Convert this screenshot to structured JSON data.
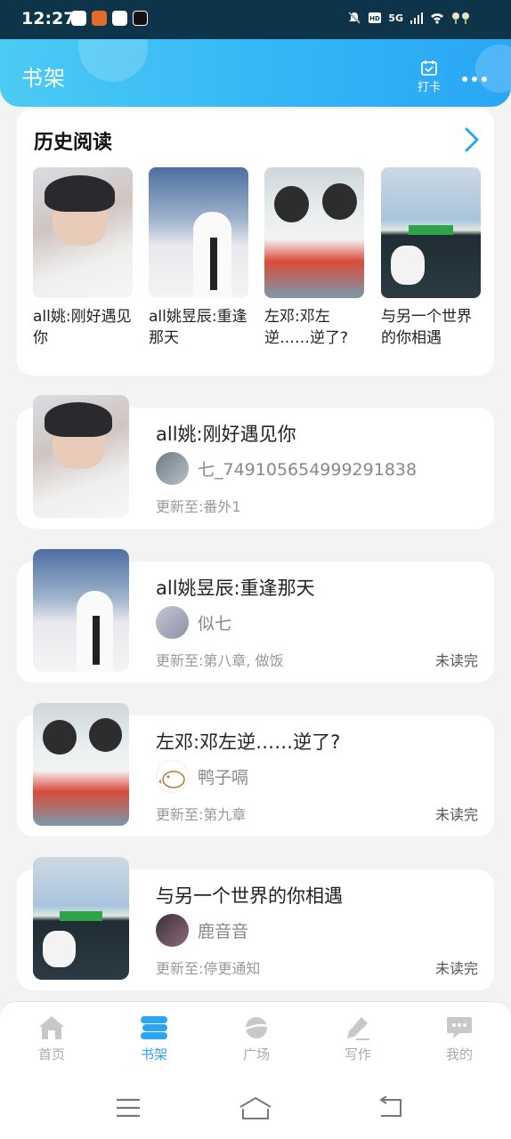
{
  "status_bar": {
    "time": "12:27",
    "network": "5G"
  },
  "header": {
    "title": "书架",
    "checkin_label": "打卡"
  },
  "history": {
    "title": "历史阅读",
    "items": [
      {
        "name": "all姚:刚好遇见你"
      },
      {
        "name": "all姚昱辰:重逢那天"
      },
      {
        "name": "左邓:邓左逆……逆了?"
      },
      {
        "name": "与另一个世界的你相遇"
      }
    ]
  },
  "shelf": {
    "update_prefix": "更新至:",
    "books": [
      {
        "title": "all姚:刚好遇见你",
        "author": "七_749105654999291838",
        "update": "更新至:番外1",
        "status": ""
      },
      {
        "title": "all姚昱辰:重逢那天",
        "author": "似七",
        "update": "更新至:第八章, 做饭",
        "status": "未读完"
      },
      {
        "title": "左邓:邓左逆……逆了?",
        "author": "鸭子嗝",
        "update": "更新至:第九章",
        "status": "未读完"
      },
      {
        "title": "与另一个世界的你相遇",
        "author": "鹿音音",
        "update": "更新至:停更通知",
        "status": "未读完"
      }
    ]
  },
  "bottom_nav": {
    "items": [
      {
        "label": "首页",
        "icon": "home-icon"
      },
      {
        "label": "书架",
        "icon": "bookshelf-icon",
        "active": true
      },
      {
        "label": "广场",
        "icon": "planet-icon"
      },
      {
        "label": "写作",
        "icon": "pen-icon"
      },
      {
        "label": "我的",
        "icon": "chat-bubble-icon"
      }
    ]
  },
  "colors": {
    "accent": "#2aa6f5",
    "header_start": "#4ccbf3",
    "status_bar": "#0d3448"
  }
}
